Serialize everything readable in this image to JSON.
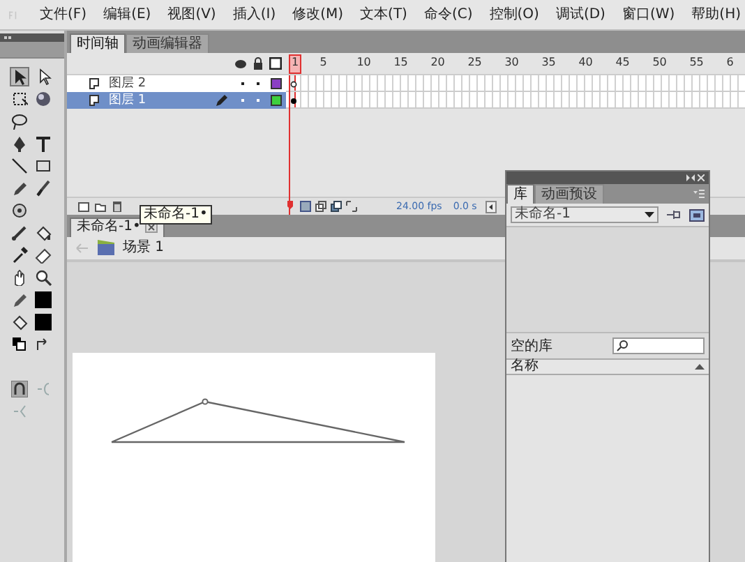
{
  "menu": [
    "文件(F)",
    "编辑(E)",
    "视图(V)",
    "插入(I)",
    "修改(M)",
    "文本(T)",
    "命令(C)",
    "控制(O)",
    "调试(D)",
    "窗口(W)",
    "帮助(H)"
  ],
  "timeline": {
    "tabs": [
      {
        "label": "时间轴",
        "selected": true
      },
      {
        "label": "动画编辑器",
        "selected": false
      }
    ],
    "frame_numbers": [
      "1",
      "5",
      "10",
      "15",
      "20",
      "25",
      "30",
      "35",
      "40",
      "45",
      "50",
      "55",
      "6"
    ],
    "layers": [
      {
        "name": "图层 2",
        "selected": false,
        "color": "#8a3fc4",
        "keyframe_filled": false
      },
      {
        "name": "图层 1",
        "selected": true,
        "color": "#3ecf3e",
        "keyframe_filled": true
      }
    ],
    "tooltip": "未命名-1•",
    "fps": "24.00 fps",
    "time": "0.0 s"
  },
  "document": {
    "tabs": [
      {
        "label": "未命名-1•",
        "selected": true
      }
    ],
    "scene": "场景 1"
  },
  "library": {
    "tabs": [
      {
        "label": "库",
        "selected": true
      },
      {
        "label": "动画预设",
        "selected": false
      }
    ],
    "document": "未命名-1",
    "status": "空的库",
    "columns": [
      "名称"
    ]
  }
}
